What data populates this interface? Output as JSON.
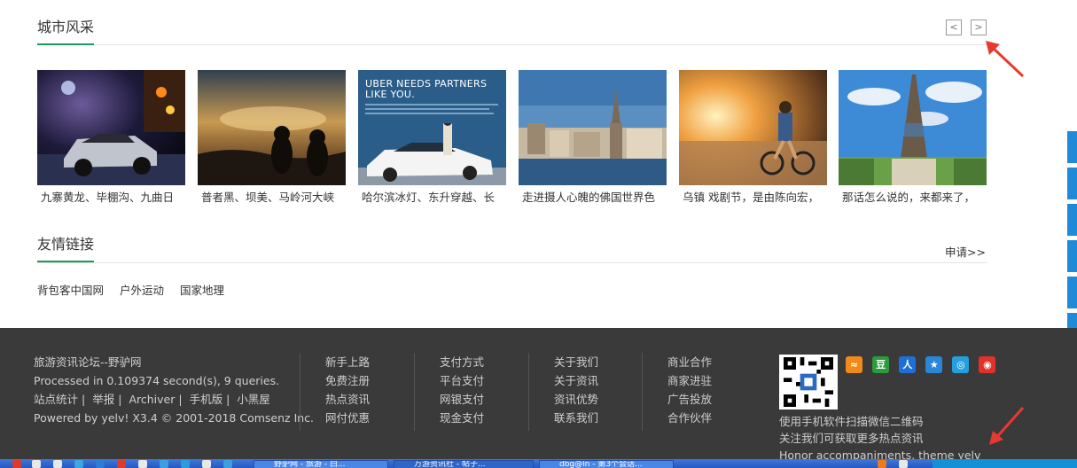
{
  "city_section": {
    "title": "城市风采",
    "prev_label": "<",
    "next_label": ">",
    "items": [
      {
        "caption": "九寨黄龙、毕棚沟、九曲日"
      },
      {
        "caption": "普者黑、坝美、马岭河大峡"
      },
      {
        "caption": "哈尔滨冰灯、东升穿越、长",
        "ad_title": "UBER NEEDS PARTNERS LIKE YOU."
      },
      {
        "caption": "走进摄人心魄的佛国世界色"
      },
      {
        "caption": "乌镇 戏剧节，是由陈向宏，"
      },
      {
        "caption": "那话怎么说的，来都来了，"
      }
    ]
  },
  "friend_links": {
    "title": "友情链接",
    "apply_label": "申请>>",
    "links": [
      "背包客中国网",
      "户外运动",
      "国家地理"
    ]
  },
  "footer": {
    "site_name": "旅游资讯论坛--野驴网",
    "processed": "Processed in 0.109374 second(s), 9 queries.",
    "small_links": [
      "站点统计",
      "举报",
      "Archiver",
      "手机版",
      "小黑屋"
    ],
    "powered": "Powered by yelv! X3.4 © 2001-2018 Comsenz Inc.",
    "columns": [
      [
        "新手上路",
        "免费注册",
        "热点资讯",
        "网付优惠"
      ],
      [
        "支付方式",
        "平台支付",
        "网银支付",
        "现金支付"
      ],
      [
        "关于我们",
        "关于资讯",
        "资讯优势",
        "联系我们"
      ],
      [
        "商业合作",
        "商家进驻",
        "广告投放",
        "合作伙伴"
      ]
    ],
    "qr_text_1": "使用手机软件扫描微信二维码",
    "qr_text_2": "关注我们可获取更多热点资讯",
    "qr_text_3": "Honor accompaniments, theme yelv",
    "social_icons": [
      "rss-icon",
      "douban-icon",
      "renren-icon",
      "qzone-icon",
      "tencent-weibo-icon",
      "sina-weibo-icon"
    ]
  },
  "taskbar": {
    "tasks": [
      "野驴网 - 旅游 - 白...",
      "万游资讯社 - 帖子...",
      "dbg@ln - 第3个会话..."
    ]
  },
  "colors": {
    "accent_green": "#1b9b5a",
    "footer_bg": "#3a3a3a",
    "side_tab_blue": "#1f8bd8",
    "annotation_red": "#e8392f"
  }
}
